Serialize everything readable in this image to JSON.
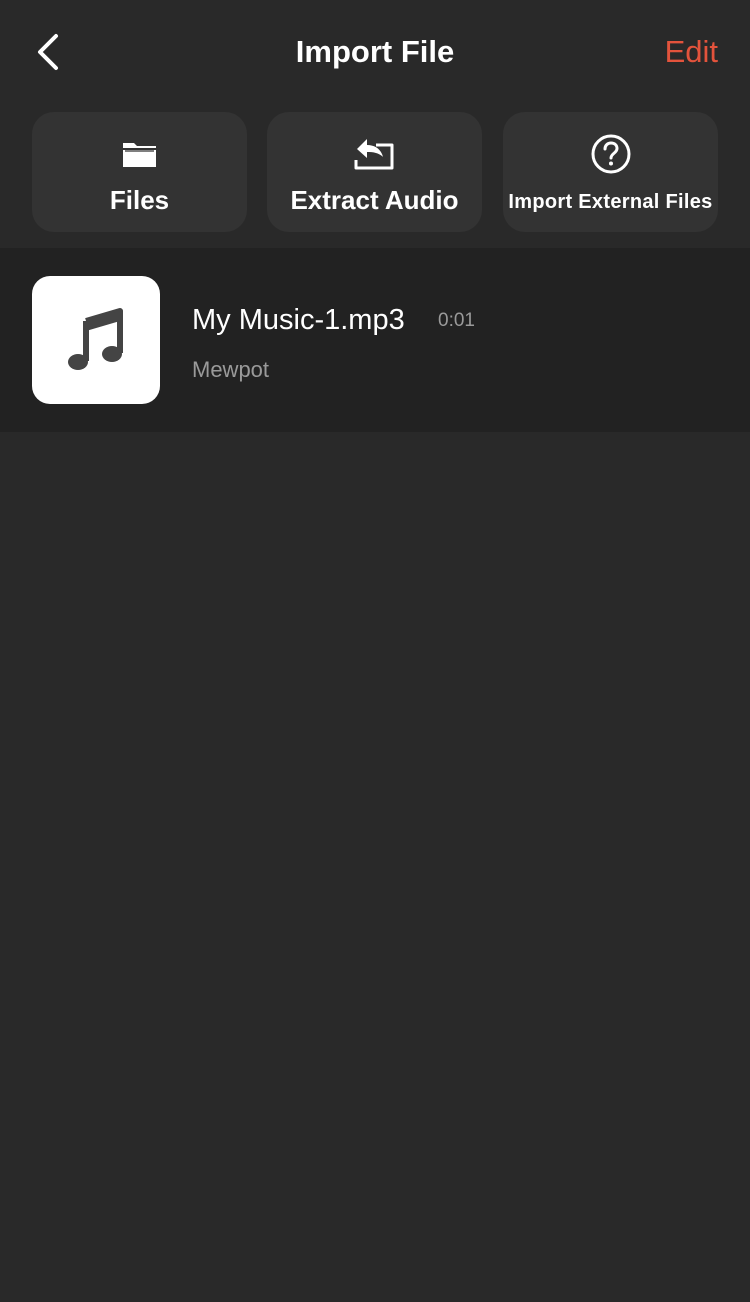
{
  "header": {
    "title": "Import File",
    "edit_label": "Edit",
    "back_icon": "chevron-left-icon"
  },
  "actions": [
    {
      "label": "Files",
      "icon": "folder-icon"
    },
    {
      "label": "Extract Audio",
      "icon": "extract-audio-icon"
    },
    {
      "label": "Import External Files",
      "icon": "help-circle-icon"
    }
  ],
  "files": [
    {
      "title": "My Music-1.mp3",
      "duration": "0:01",
      "subtitle": "Mewpot",
      "icon": "music-note-icon"
    }
  ],
  "colors": {
    "background": "#292929",
    "card": "#333333",
    "list_background": "#222222",
    "accent": "#e3533c",
    "secondary_text": "#9a9a9a"
  }
}
